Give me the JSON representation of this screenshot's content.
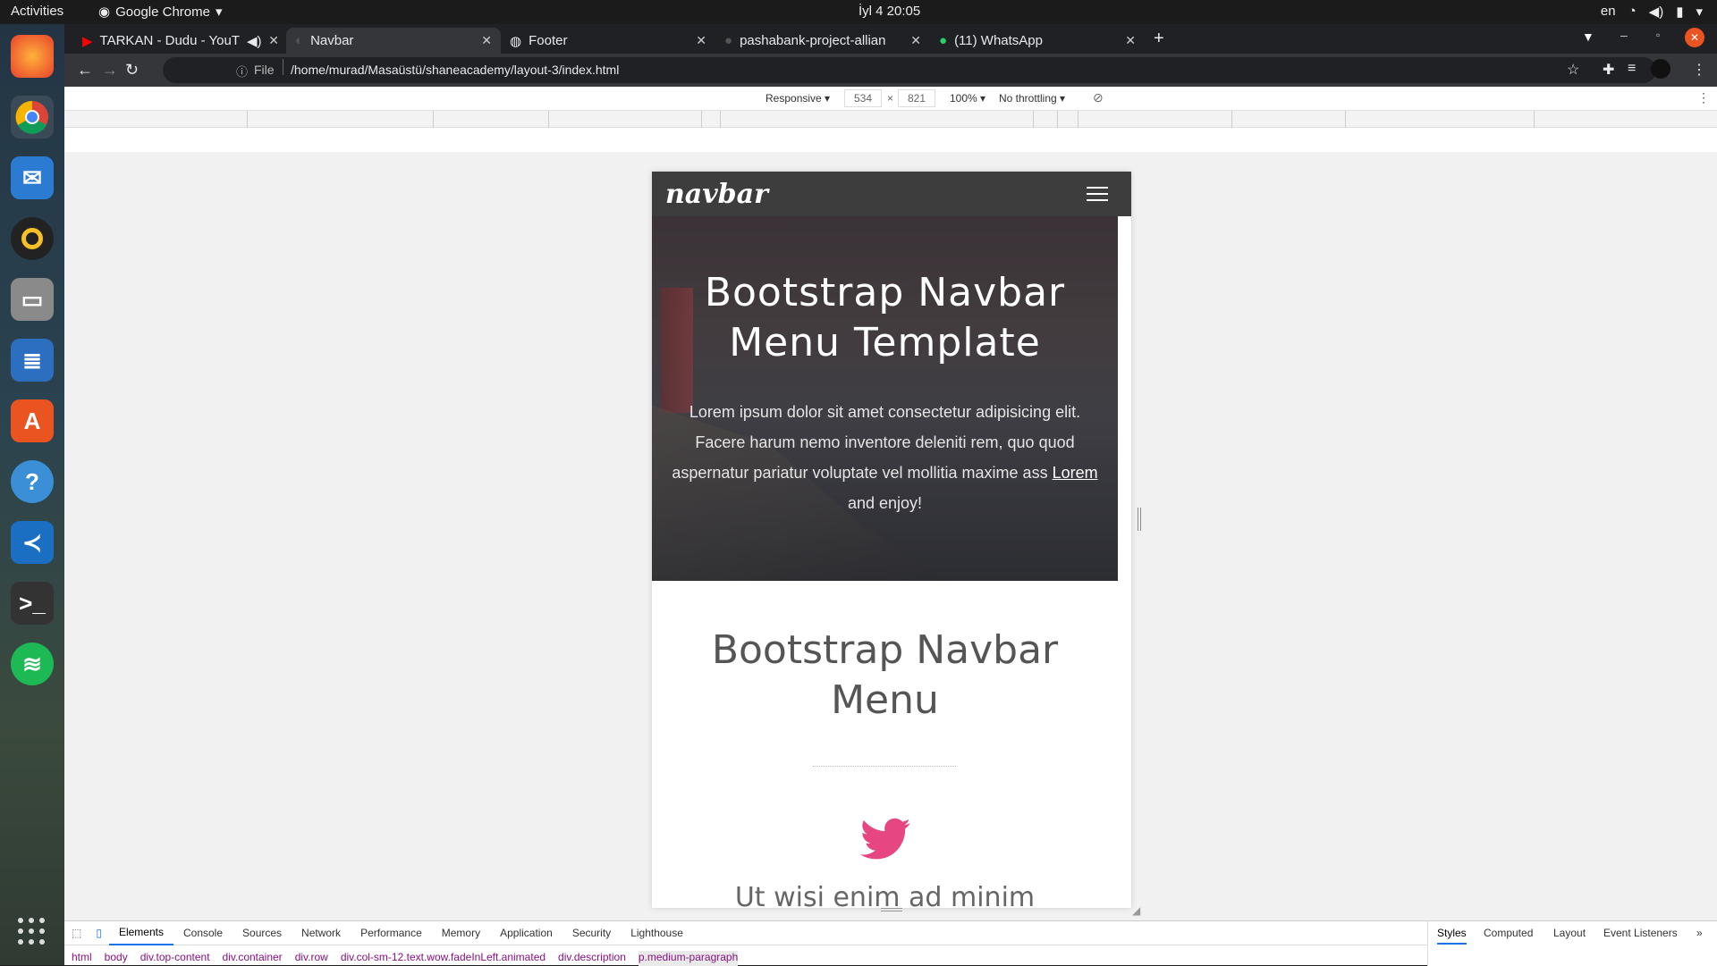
{
  "topbar": {
    "activities": "Activities",
    "app": "Google Chrome",
    "clock": "İyl 4  20:05",
    "lang": "en"
  },
  "tabs": [
    {
      "label": "TARKAN - Dudu - YouT",
      "icon": "youtube-icon"
    },
    {
      "label": "Navbar",
      "icon": "page-icon"
    },
    {
      "label": "Footer",
      "icon": "globe-icon"
    },
    {
      "label": "pashabank-project-allian",
      "icon": "github-icon"
    },
    {
      "label": "(11) WhatsApp",
      "icon": "whatsapp-icon"
    }
  ],
  "toolbar": {
    "file_label": "File",
    "url": "/home/murad/Masaüstü/shaneacademy/layout-3/index.html"
  },
  "device_toolbar": {
    "mode": "Responsive",
    "width": "534",
    "height": "821",
    "zoom": "100%",
    "throttle": "No throttling"
  },
  "page": {
    "brand": "navbar",
    "hero_title": "Bootstrap Navbar Menu Template",
    "hero_text": "Lorem ipsum dolor sit amet consectetur adipisicing elit. Facere harum nemo inventore deleniti rem, quo quod aspernatur pariatur voluptate vel mollitia maxime ass",
    "hero_link": "Lorem",
    "hero_text_end": "and enjoy!",
    "section_title": "Bootstrap Navbar Menu",
    "feature_title": "Ut wisi enim ad minim"
  },
  "devtools": {
    "tabs": [
      "Elements",
      "Console",
      "Sources",
      "Network",
      "Performance",
      "Memory",
      "Application",
      "Security",
      "Lighthouse"
    ],
    "breadcrumbs": [
      "html",
      "body",
      "div.top-content",
      "div.container",
      "div.row",
      "div.col-sm-12.text.wow.fadeInLeft.animated",
      "div.description",
      "p.medium-paragraph"
    ],
    "side_tabs": [
      "Styles",
      "Computed",
      "Layout",
      "Event Listeners"
    ]
  },
  "colors": {
    "accent": "#e64682",
    "nav": "#3d3d3d"
  }
}
